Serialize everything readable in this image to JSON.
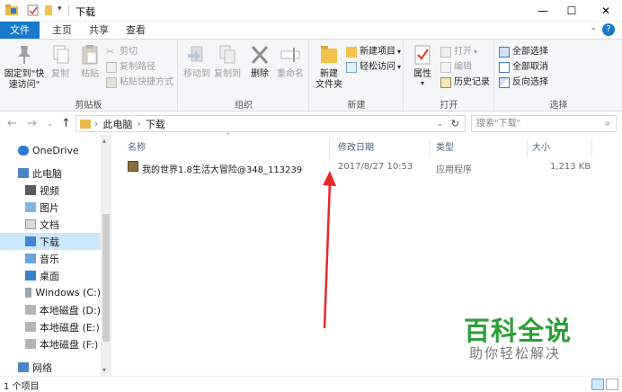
{
  "window": {
    "title": "下载",
    "minimize": "—",
    "maximize": "☐",
    "close": "✕"
  },
  "tabs": [
    "文件",
    "主页",
    "共享",
    "查看"
  ],
  "ribbon": {
    "clipboard": {
      "label": "剪贴板",
      "pin_label_1": "固定到\"快",
      "pin_label_2": "速访问\"",
      "copy": "复制",
      "paste": "粘贴",
      "cut": "剪切",
      "copy_path": "复制路径",
      "paste_shortcut": "粘贴快捷方式"
    },
    "organize": {
      "label": "组织",
      "move_to": "移动到",
      "copy_to": "复制到",
      "delete": "删除",
      "rename": "重命名"
    },
    "new": {
      "label": "新建",
      "new_folder_1": "新建",
      "new_folder_2": "文件夹",
      "new_item": "新建项目",
      "easy_access": "轻松访问"
    },
    "open": {
      "label": "打开",
      "properties": "属性",
      "open": "打开",
      "edit": "编辑",
      "history": "历史记录"
    },
    "select": {
      "label": "选择",
      "select_all": "全部选择",
      "select_none": "全部取消",
      "invert": "反向选择"
    }
  },
  "address": {
    "crumb1": "此电脑",
    "crumb2": "下载",
    "search_placeholder": "搜索\"下载\""
  },
  "nav": {
    "items": [
      "OneDrive",
      "此电脑",
      "视频",
      "图片",
      "文档",
      "下载",
      "音乐",
      "桌面",
      "Windows (C:)",
      "本地磁盘 (D:)",
      "本地磁盘 (E:)",
      "本地磁盘 (F:)",
      "网络"
    ]
  },
  "columns": {
    "name": "名称",
    "modified": "修改日期",
    "type": "类型",
    "size": "大小"
  },
  "files": [
    {
      "name": "我的世界1.8生活大冒险@348_113239",
      "modified": "2017/8/27 10:53",
      "type": "应用程序",
      "size": "1,213 KB"
    }
  ],
  "status": {
    "count": "1 个项目"
  },
  "watermark": {
    "big": "百科全说",
    "small": "助你轻松解决"
  },
  "colors": {
    "accent": "#1979ca",
    "selected": "#cce8ff",
    "arrow": "#e8282a",
    "watermark": "#2e9d36"
  }
}
